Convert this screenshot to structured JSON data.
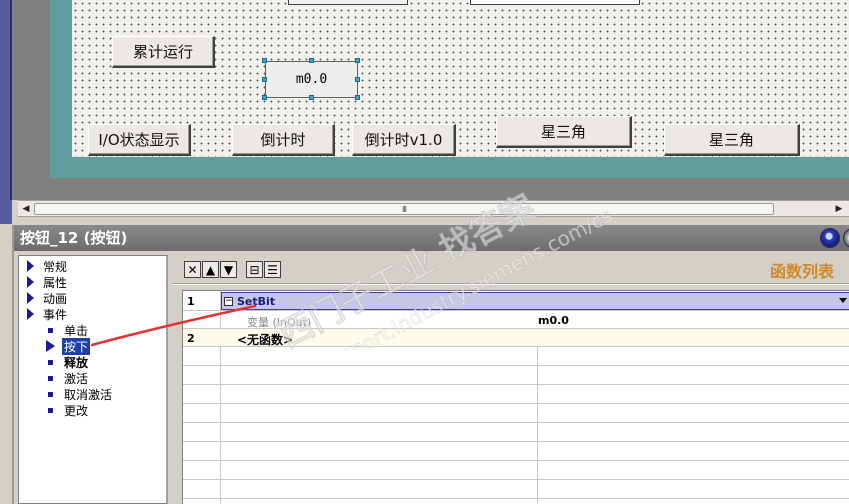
{
  "canvas": {
    "buttons": {
      "cumulative_run": "累计运行",
      "io_status": "I/O状态显示",
      "countdown": "倒计时",
      "countdown_v1": "倒计时v1.0",
      "star_delta_1": "星三角",
      "star_delta_2": "星三角"
    },
    "io_field_value": "m0.0"
  },
  "scrollbar": {
    "thumb_grip": "III"
  },
  "properties": {
    "title": "按钮_12 (按钮)",
    "tree": {
      "general": "常规",
      "properties": "属性",
      "animation": "动画",
      "events": "事件",
      "click": "单击",
      "press": "按下",
      "release": "释放",
      "activate": "激活",
      "deactivate": "取消激活",
      "change": "更改"
    },
    "function_list": {
      "title": "函数列表",
      "rows": [
        {
          "num": "1",
          "function": "SetBit",
          "param_label": "变量 (InOut)",
          "param_value": "m0.0"
        },
        {
          "num": "2",
          "function": "<无函数>"
        }
      ]
    }
  },
  "watermark": {
    "line1": "西门子工业 找答案",
    "line2": "support.industry.siemens.com/cs"
  },
  "colors": {
    "teal_frame": "#5f9e9c",
    "selection": "#1e3fa8",
    "function_list_title": "#d08a2a",
    "annotation": "#e83030"
  }
}
